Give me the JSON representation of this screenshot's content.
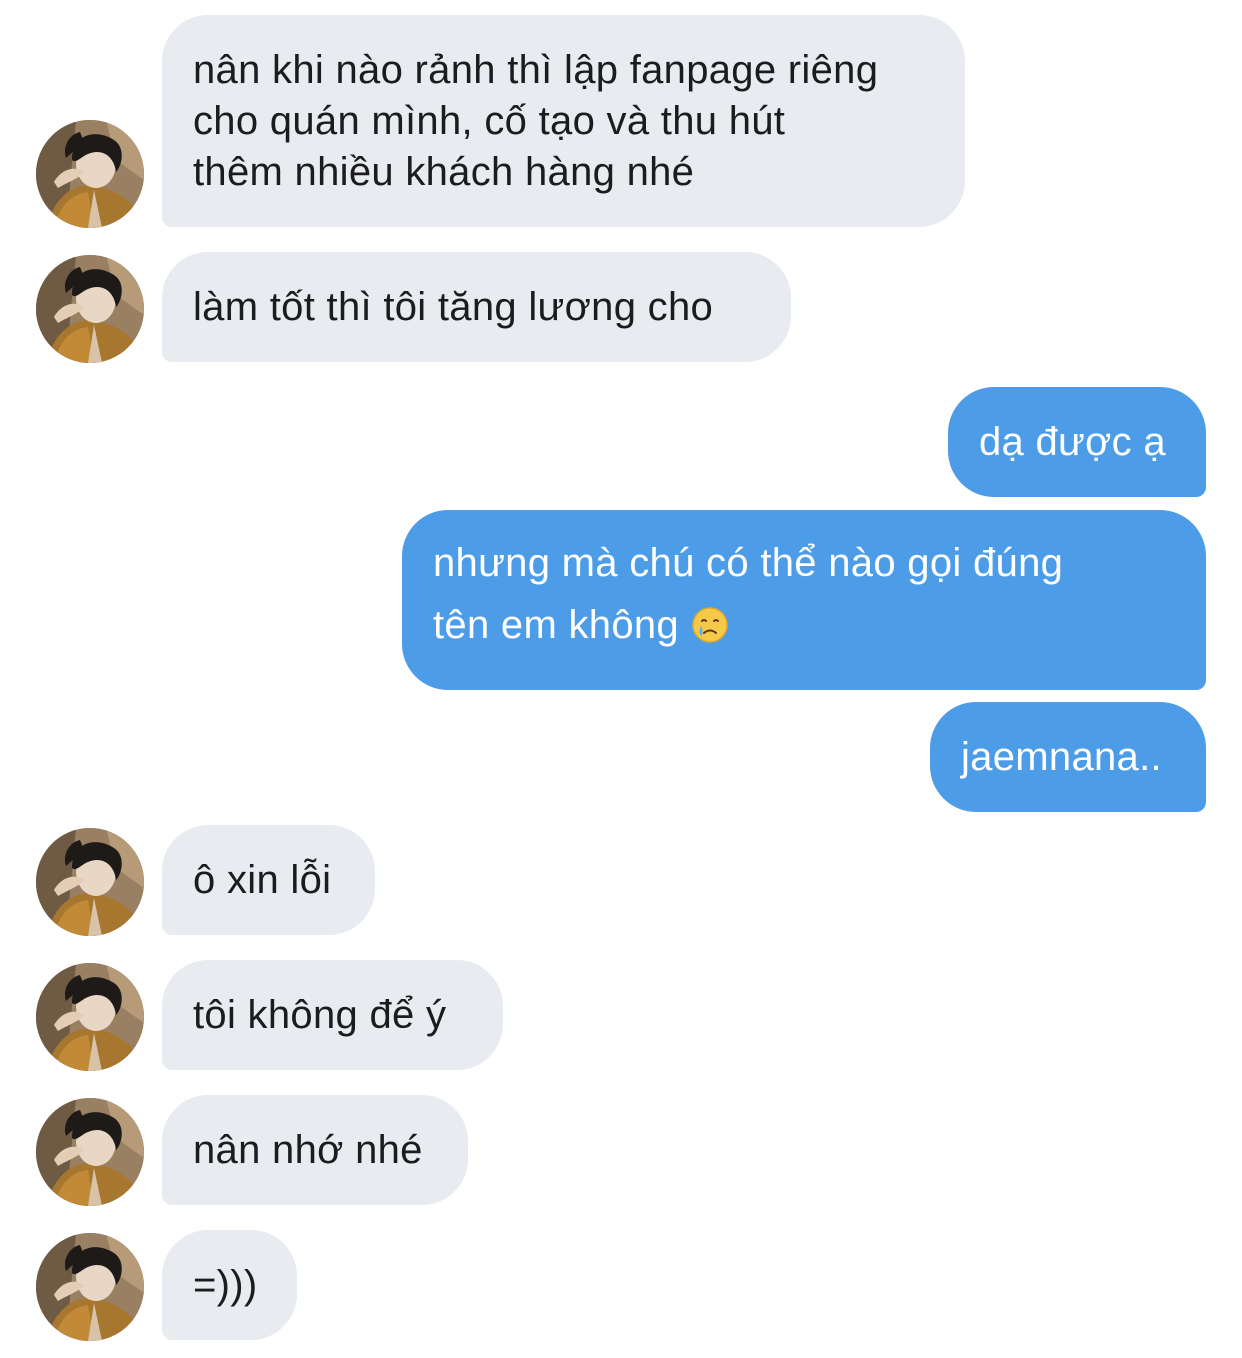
{
  "colors": {
    "incoming_bubble": "#e8ebef",
    "outgoing_bubble": "#4d9ce8",
    "incoming_text": "#1c1c1e",
    "outgoing_text": "#ffffff"
  },
  "messages": [
    {
      "from": "other",
      "text": "nân khi nào rảnh thì lập fanpage riêng\ncho quán mình, cố tạo và thu hút\nthêm nhiều khách hàng nhé"
    },
    {
      "from": "other",
      "text": "làm tốt thì tôi tăng lương cho"
    },
    {
      "from": "me",
      "text": "dạ được ạ"
    },
    {
      "from": "me",
      "text": "nhưng mà chú có thể nào gọi đúng\ntên em không",
      "emoji": "crying-face-emoji"
    },
    {
      "from": "me",
      "text": "jaemnana.."
    },
    {
      "from": "other",
      "text": "ô xin lỗi"
    },
    {
      "from": "other",
      "text": "tôi không để ý"
    },
    {
      "from": "other",
      "text": "nân nhớ nhé"
    },
    {
      "from": "other",
      "text": "=)))"
    }
  ]
}
